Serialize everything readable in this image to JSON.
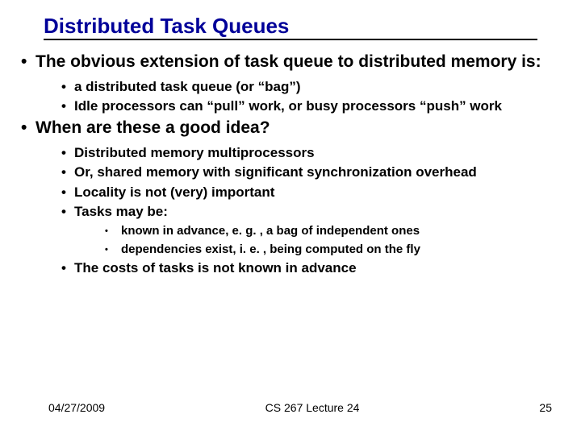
{
  "title": "Distributed Task Queues",
  "bullets": {
    "b1": "The obvious extension of task queue to distributed memory is:",
    "b1a": "a distributed task queue (or “bag”)",
    "b1b": "Idle processors can “pull” work, or busy processors “push” work",
    "b2": "When are these a good idea?",
    "b2a": "Distributed memory multiprocessors",
    "b2b": "Or, shared memory with significant synchronization overhead",
    "b2c": "Locality is not (very) important",
    "b2d": "Tasks may be:",
    "b2d1": "known in advance, e. g. , a bag of independent ones",
    "b2d2": "dependencies exist, i. e. , being computed on the fly",
    "b2e": "The costs of tasks is not known in advance"
  },
  "footer": {
    "date": "04/27/2009",
    "center": "CS 267 Lecture 24",
    "page": "25"
  }
}
